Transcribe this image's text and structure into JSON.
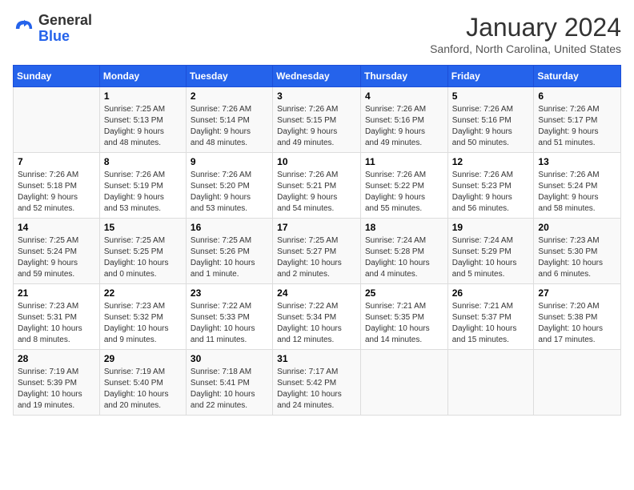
{
  "header": {
    "logo_general": "General",
    "logo_blue": "Blue",
    "month_title": "January 2024",
    "location": "Sanford, North Carolina, United States"
  },
  "days_of_week": [
    "Sunday",
    "Monday",
    "Tuesday",
    "Wednesday",
    "Thursday",
    "Friday",
    "Saturday"
  ],
  "weeks": [
    [
      {
        "day": "",
        "info": ""
      },
      {
        "day": "1",
        "info": "Sunrise: 7:25 AM\nSunset: 5:13 PM\nDaylight: 9 hours\nand 48 minutes."
      },
      {
        "day": "2",
        "info": "Sunrise: 7:26 AM\nSunset: 5:14 PM\nDaylight: 9 hours\nand 48 minutes."
      },
      {
        "day": "3",
        "info": "Sunrise: 7:26 AM\nSunset: 5:15 PM\nDaylight: 9 hours\nand 49 minutes."
      },
      {
        "day": "4",
        "info": "Sunrise: 7:26 AM\nSunset: 5:16 PM\nDaylight: 9 hours\nand 49 minutes."
      },
      {
        "day": "5",
        "info": "Sunrise: 7:26 AM\nSunset: 5:16 PM\nDaylight: 9 hours\nand 50 minutes."
      },
      {
        "day": "6",
        "info": "Sunrise: 7:26 AM\nSunset: 5:17 PM\nDaylight: 9 hours\nand 51 minutes."
      }
    ],
    [
      {
        "day": "7",
        "info": "Sunrise: 7:26 AM\nSunset: 5:18 PM\nDaylight: 9 hours\nand 52 minutes."
      },
      {
        "day": "8",
        "info": "Sunrise: 7:26 AM\nSunset: 5:19 PM\nDaylight: 9 hours\nand 53 minutes."
      },
      {
        "day": "9",
        "info": "Sunrise: 7:26 AM\nSunset: 5:20 PM\nDaylight: 9 hours\nand 53 minutes."
      },
      {
        "day": "10",
        "info": "Sunrise: 7:26 AM\nSunset: 5:21 PM\nDaylight: 9 hours\nand 54 minutes."
      },
      {
        "day": "11",
        "info": "Sunrise: 7:26 AM\nSunset: 5:22 PM\nDaylight: 9 hours\nand 55 minutes."
      },
      {
        "day": "12",
        "info": "Sunrise: 7:26 AM\nSunset: 5:23 PM\nDaylight: 9 hours\nand 56 minutes."
      },
      {
        "day": "13",
        "info": "Sunrise: 7:26 AM\nSunset: 5:24 PM\nDaylight: 9 hours\nand 58 minutes."
      }
    ],
    [
      {
        "day": "14",
        "info": "Sunrise: 7:25 AM\nSunset: 5:24 PM\nDaylight: 9 hours\nand 59 minutes."
      },
      {
        "day": "15",
        "info": "Sunrise: 7:25 AM\nSunset: 5:25 PM\nDaylight: 10 hours\nand 0 minutes."
      },
      {
        "day": "16",
        "info": "Sunrise: 7:25 AM\nSunset: 5:26 PM\nDaylight: 10 hours\nand 1 minute."
      },
      {
        "day": "17",
        "info": "Sunrise: 7:25 AM\nSunset: 5:27 PM\nDaylight: 10 hours\nand 2 minutes."
      },
      {
        "day": "18",
        "info": "Sunrise: 7:24 AM\nSunset: 5:28 PM\nDaylight: 10 hours\nand 4 minutes."
      },
      {
        "day": "19",
        "info": "Sunrise: 7:24 AM\nSunset: 5:29 PM\nDaylight: 10 hours\nand 5 minutes."
      },
      {
        "day": "20",
        "info": "Sunrise: 7:23 AM\nSunset: 5:30 PM\nDaylight: 10 hours\nand 6 minutes."
      }
    ],
    [
      {
        "day": "21",
        "info": "Sunrise: 7:23 AM\nSunset: 5:31 PM\nDaylight: 10 hours\nand 8 minutes."
      },
      {
        "day": "22",
        "info": "Sunrise: 7:23 AM\nSunset: 5:32 PM\nDaylight: 10 hours\nand 9 minutes."
      },
      {
        "day": "23",
        "info": "Sunrise: 7:22 AM\nSunset: 5:33 PM\nDaylight: 10 hours\nand 11 minutes."
      },
      {
        "day": "24",
        "info": "Sunrise: 7:22 AM\nSunset: 5:34 PM\nDaylight: 10 hours\nand 12 minutes."
      },
      {
        "day": "25",
        "info": "Sunrise: 7:21 AM\nSunset: 5:35 PM\nDaylight: 10 hours\nand 14 minutes."
      },
      {
        "day": "26",
        "info": "Sunrise: 7:21 AM\nSunset: 5:37 PM\nDaylight: 10 hours\nand 15 minutes."
      },
      {
        "day": "27",
        "info": "Sunrise: 7:20 AM\nSunset: 5:38 PM\nDaylight: 10 hours\nand 17 minutes."
      }
    ],
    [
      {
        "day": "28",
        "info": "Sunrise: 7:19 AM\nSunset: 5:39 PM\nDaylight: 10 hours\nand 19 minutes."
      },
      {
        "day": "29",
        "info": "Sunrise: 7:19 AM\nSunset: 5:40 PM\nDaylight: 10 hours\nand 20 minutes."
      },
      {
        "day": "30",
        "info": "Sunrise: 7:18 AM\nSunset: 5:41 PM\nDaylight: 10 hours\nand 22 minutes."
      },
      {
        "day": "31",
        "info": "Sunrise: 7:17 AM\nSunset: 5:42 PM\nDaylight: 10 hours\nand 24 minutes."
      },
      {
        "day": "",
        "info": ""
      },
      {
        "day": "",
        "info": ""
      },
      {
        "day": "",
        "info": ""
      }
    ]
  ]
}
